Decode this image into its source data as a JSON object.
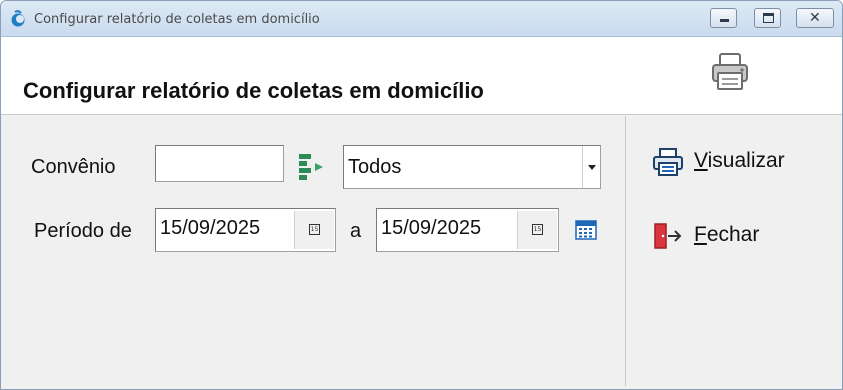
{
  "window": {
    "title": "Configurar relatório de coletas em domicílio"
  },
  "header": {
    "title": "Configurar relatório de coletas em domicílio",
    "icon": "printer-icon"
  },
  "form": {
    "convenio": {
      "label": "Convênio",
      "code_value": "",
      "selected": "Todos"
    },
    "periodo": {
      "label": "Período de",
      "start": "15/09/2025",
      "separator": "a",
      "end": "15/09/2025",
      "date_button_glyph": "15"
    }
  },
  "actions": {
    "visualizar": "Visualizar",
    "fechar": "Fechar"
  },
  "colors": {
    "accent_blue": "#1e66b8",
    "lookup_green": "#2e8b57",
    "exit_red": "#d9363e"
  }
}
